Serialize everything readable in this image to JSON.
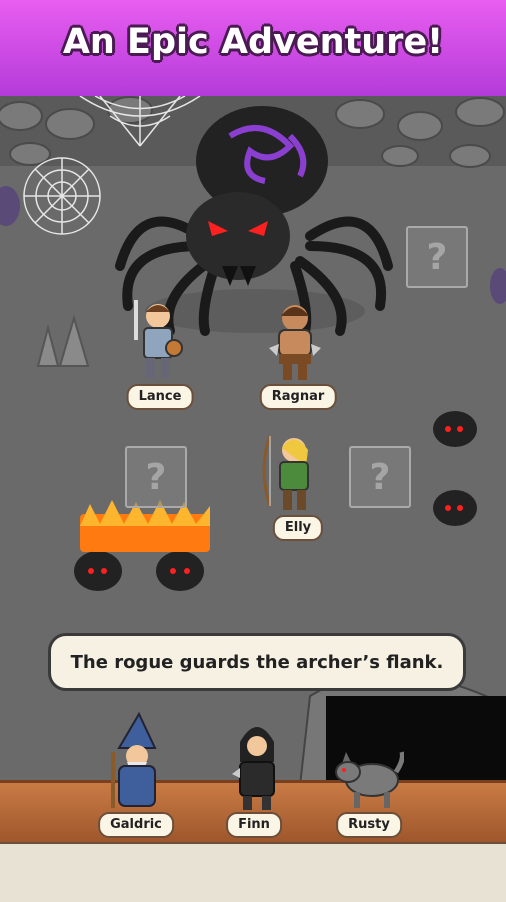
{
  "banner": {
    "title": "An Epic Adventure!"
  },
  "party_top": [
    {
      "name": "Lance"
    },
    {
      "name": "Ragnar"
    },
    {
      "name": "Elly"
    }
  ],
  "party_bench": [
    {
      "name": "Galdric"
    },
    {
      "name": "Finn"
    },
    {
      "name": "Rusty"
    }
  ],
  "hidden_slot_label": "?",
  "dialog": {
    "text": "The rogue guards the archer’s flank."
  },
  "colors": {
    "banner": "#c94ae0",
    "cave_floor": "#6a6a6a",
    "wood": "#b8683a",
    "enemy_eyes": "#ff2020",
    "fire": "#ff9a1a"
  }
}
